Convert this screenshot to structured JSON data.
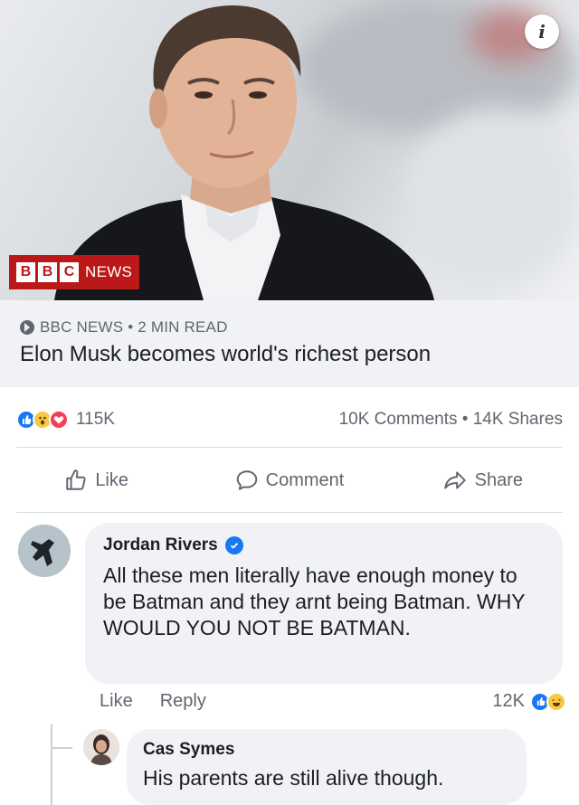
{
  "post": {
    "image_badge": {
      "boxes": [
        "B",
        "B",
        "C"
      ],
      "word": "NEWS"
    },
    "info_button": "i",
    "source_line": "BBC NEWS • 2 MIN READ",
    "headline": "Elon Musk becomes world's richest person"
  },
  "reactions": {
    "icons": [
      "like-reaction",
      "wow-reaction",
      "love-reaction"
    ],
    "count": "115K",
    "stats": "10K Comments • 14K Shares"
  },
  "actions": [
    {
      "label": "Like",
      "icon": "thumbs-up-icon"
    },
    {
      "label": "Comment",
      "icon": "speech-bubble-icon"
    },
    {
      "label": "Share",
      "icon": "share-arrow-icon"
    }
  ],
  "comments": [
    {
      "author": "Jordan Rivers",
      "verified": true,
      "text": "All these men literally have enough money to be Batman and they arnt being Batman. WHY WOULD YOU NOT BE BATMAN.",
      "like_label": "Like",
      "reply_label": "Reply",
      "reaction_count": "12K"
    },
    {
      "author": "Cas Symes",
      "text": "His parents are still alive though."
    }
  ],
  "colors": {
    "accent": "#1877f2",
    "bbc_red": "#bb1919",
    "muted": "#606770",
    "bubble": "#f0f2f5"
  }
}
